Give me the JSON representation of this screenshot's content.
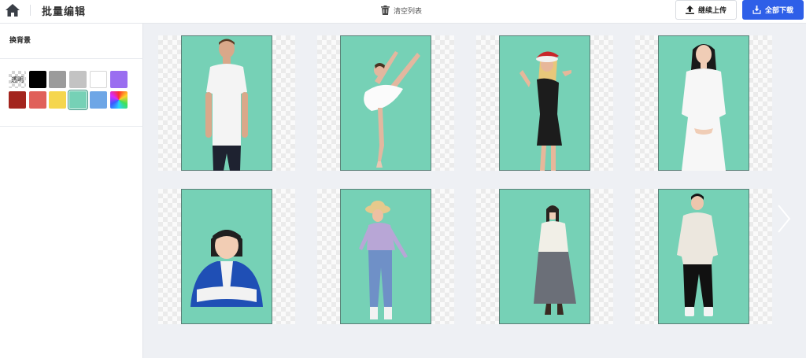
{
  "header": {
    "title": "批量编辑",
    "clear_label": "清空列表",
    "continue_label": "继续上传",
    "download_label": "全部下载",
    "accent_color": "#2e5fe8"
  },
  "sidebar": {
    "title": "换背景",
    "swatches": [
      {
        "name": "transparent",
        "label": "透明"
      },
      {
        "name": "black",
        "color": "#000000"
      },
      {
        "name": "gray",
        "color": "#9b9b9b"
      },
      {
        "name": "light-gray",
        "color": "#c3c3c3"
      },
      {
        "name": "white",
        "color": "#ffffff"
      },
      {
        "name": "purple",
        "color": "#9a6ef0"
      },
      {
        "name": "dark-red",
        "color": "#a3241d"
      },
      {
        "name": "salmon",
        "color": "#e0605a"
      },
      {
        "name": "yellow",
        "color": "#f5d64e"
      },
      {
        "name": "mint",
        "color": "#76d1b6",
        "selected": true
      },
      {
        "name": "light-blue",
        "color": "#6ea6e6"
      },
      {
        "name": "rainbow",
        "color": "multicolor"
      }
    ]
  },
  "gallery": {
    "background_color": "#76d1b6",
    "images": [
      {
        "name": "man-white-tshirt"
      },
      {
        "name": "ballet-dancer"
      },
      {
        "name": "singer-santa-hat"
      },
      {
        "name": "woman-white-dress"
      },
      {
        "name": "girl-blue-jacket"
      },
      {
        "name": "woman-straw-hat"
      },
      {
        "name": "girl-braids-skirt"
      },
      {
        "name": "man-white-sweater"
      }
    ]
  },
  "icons": {
    "home": "home-icon",
    "trash": "trash-icon",
    "upload": "upload-icon",
    "download": "download-icon",
    "prev": "chevron-left-icon",
    "next": "chevron-right-icon"
  }
}
